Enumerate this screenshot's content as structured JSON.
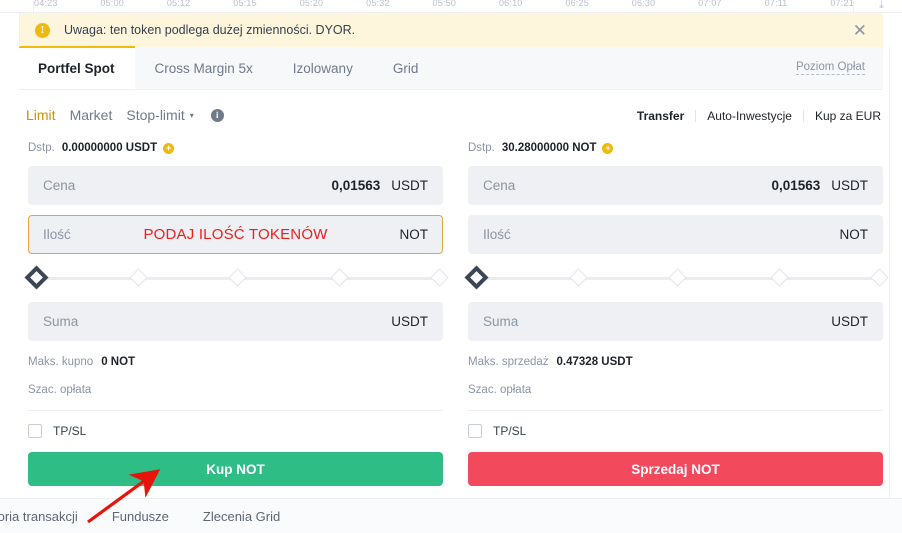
{
  "chart_axis": {
    "ticks": [
      "04:23",
      "05:00",
      "05:12",
      "05:15",
      "05:20",
      "05:32",
      "05:50",
      "06:10",
      "06:25",
      "06:30",
      "07:07",
      "07:11",
      "07:21"
    ],
    "download_icon": "download-icon"
  },
  "banner": {
    "icon": "warning-exclamation-icon",
    "text": "Uwaga: ten token podlega dużej zmienności. DYOR.",
    "close_icon": "✕",
    "bg_color": "#fdf6dd",
    "icon_color": "#f0b90b"
  },
  "tabs": {
    "items": [
      {
        "label": "Portfel Spot",
        "active": true
      },
      {
        "label": "Cross Margin 5x",
        "active": false
      },
      {
        "label": "Izolowany",
        "active": false
      },
      {
        "label": "Grid",
        "active": false
      }
    ],
    "fee_link": "Poziom Opłat",
    "active_indicator_color": "#f0b90b"
  },
  "order_types": {
    "items": [
      {
        "label": "Limit",
        "active": true
      },
      {
        "label": "Market",
        "active": false
      },
      {
        "label": "Stop-limit",
        "active": false
      }
    ],
    "caret": "▾",
    "info_icon": "i",
    "active_color": "#c99400"
  },
  "top_links": [
    {
      "label": "Transfer",
      "bold": true
    },
    {
      "label": "Auto-Inwestycje",
      "bold": false
    },
    {
      "label": "Kup za EUR",
      "bold": false
    }
  ],
  "buy_panel": {
    "available": {
      "label": "Dstp.",
      "value": "0.00000000 USDT",
      "plus_icon": "+"
    },
    "price": {
      "label": "Cena",
      "value": "0,01563",
      "unit": "USDT"
    },
    "amount": {
      "label": "Ilość",
      "value": "",
      "unit": "NOT",
      "annotation": "PODAJ ILOŚĆ TOKENÓW",
      "annotation_color": "#f01d1d",
      "highlighted": true
    },
    "slider": {
      "value": 0,
      "stops": [
        0,
        25,
        50,
        75,
        100
      ]
    },
    "total": {
      "label": "Suma",
      "value": "",
      "unit": "USDT"
    },
    "max": {
      "label": "Maks. kupno",
      "value": "0 NOT"
    },
    "fee": {
      "label": "Szac. opłata",
      "value": ""
    },
    "tpsl": {
      "label": "TP/SL",
      "checked": false
    },
    "button": {
      "label": "Kup NOT",
      "color": "#2ebd85"
    }
  },
  "sell_panel": {
    "available": {
      "label": "Dstp.",
      "value": "30.28000000 NOT",
      "plus_icon": "+"
    },
    "price": {
      "label": "Cena",
      "value": "0,01563",
      "unit": "USDT"
    },
    "amount": {
      "label": "Ilość",
      "value": "",
      "unit": "NOT",
      "annotation": "",
      "highlighted": false
    },
    "slider": {
      "value": 0,
      "stops": [
        0,
        25,
        50,
        75,
        100
      ]
    },
    "total": {
      "label": "Suma",
      "value": "",
      "unit": "USDT"
    },
    "max": {
      "label": "Maks. sprzedaż",
      "value": "0.47328 USDT"
    },
    "fee": {
      "label": "Szac. opłata",
      "value": ""
    },
    "tpsl": {
      "label": "TP/SL",
      "checked": false
    },
    "button": {
      "label": "Sprzedaj NOT",
      "color": "#f2495c"
    }
  },
  "footer": {
    "items": [
      "toria transakcji",
      "Fundusze",
      "Zlecenia Grid"
    ]
  },
  "annotation_arrow": {
    "color": "#e8140c",
    "from": [
      88,
      522
    ],
    "to": [
      158,
      471
    ]
  }
}
